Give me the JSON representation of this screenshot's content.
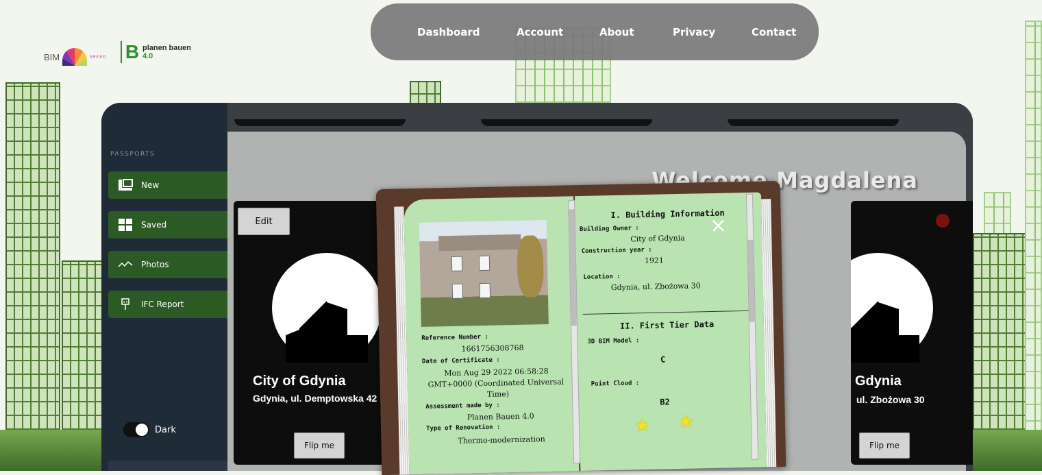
{
  "logos": {
    "bim": "BIM",
    "bim_sub": "SPEED",
    "pb_line1": "planen bauen",
    "pb_line2": "4.0"
  },
  "nav": [
    "Dashboard",
    "Account",
    "About",
    "Privacy",
    "Contact"
  ],
  "sidebar": {
    "heading": "PASSPORTS",
    "items": [
      {
        "label": "New",
        "icon": "new-passport-icon"
      },
      {
        "label": "Saved",
        "icon": "grid-icon"
      },
      {
        "label": "Photos",
        "icon": "chart-line-icon"
      },
      {
        "label": "IFC Report",
        "icon": "plug-icon"
      }
    ],
    "theme_toggle": "Dark"
  },
  "welcome": "Welcome Magdalena",
  "cards": [
    {
      "edit": "Edit",
      "title": "City of Gdynia",
      "address": "Gdynia, ul. Demptowska 42",
      "flip": "Flip me"
    },
    {
      "title": "Gdynia",
      "address": "ul. Zbożowa 30",
      "flip": "Flip me"
    }
  ],
  "book": {
    "left": {
      "ref_label": "Reference Number :",
      "ref_value": "1661756308768",
      "date_label": "Date of Certificate :",
      "date_line1": "Mon Aug 29 2022 06:58:28",
      "date_line2": "GMT+0000 (Coordinated Universal",
      "date_line3": "Time)",
      "assessed_label": "Assessment made by :",
      "assessed_value": "Planen Bauen 4.0",
      "renovation_label": "Type of Renovation :",
      "renovation_value": "Thermo-modernization"
    },
    "right": {
      "section1": "I. Building Information",
      "owner_label": "Building Owner :",
      "owner_value": "City of Gdynia",
      "year_label": "Construction year :",
      "year_value": "1921",
      "location_label": "Location :",
      "location_value": "Gdynia, ul. Zbożowa 30",
      "section2": "II. First Tier Data",
      "bim_label": "3D BIM Model :",
      "bim_value": "C",
      "cloud_label": "Point Cloud :",
      "cloud_value": "B2",
      "close": "×",
      "stars": 2
    }
  },
  "colors": {
    "sidebar": "#1f2b37",
    "sidebar_item": "#2c5a25",
    "page": "#b9e4b1",
    "book_cover": "#5a3a2a"
  }
}
